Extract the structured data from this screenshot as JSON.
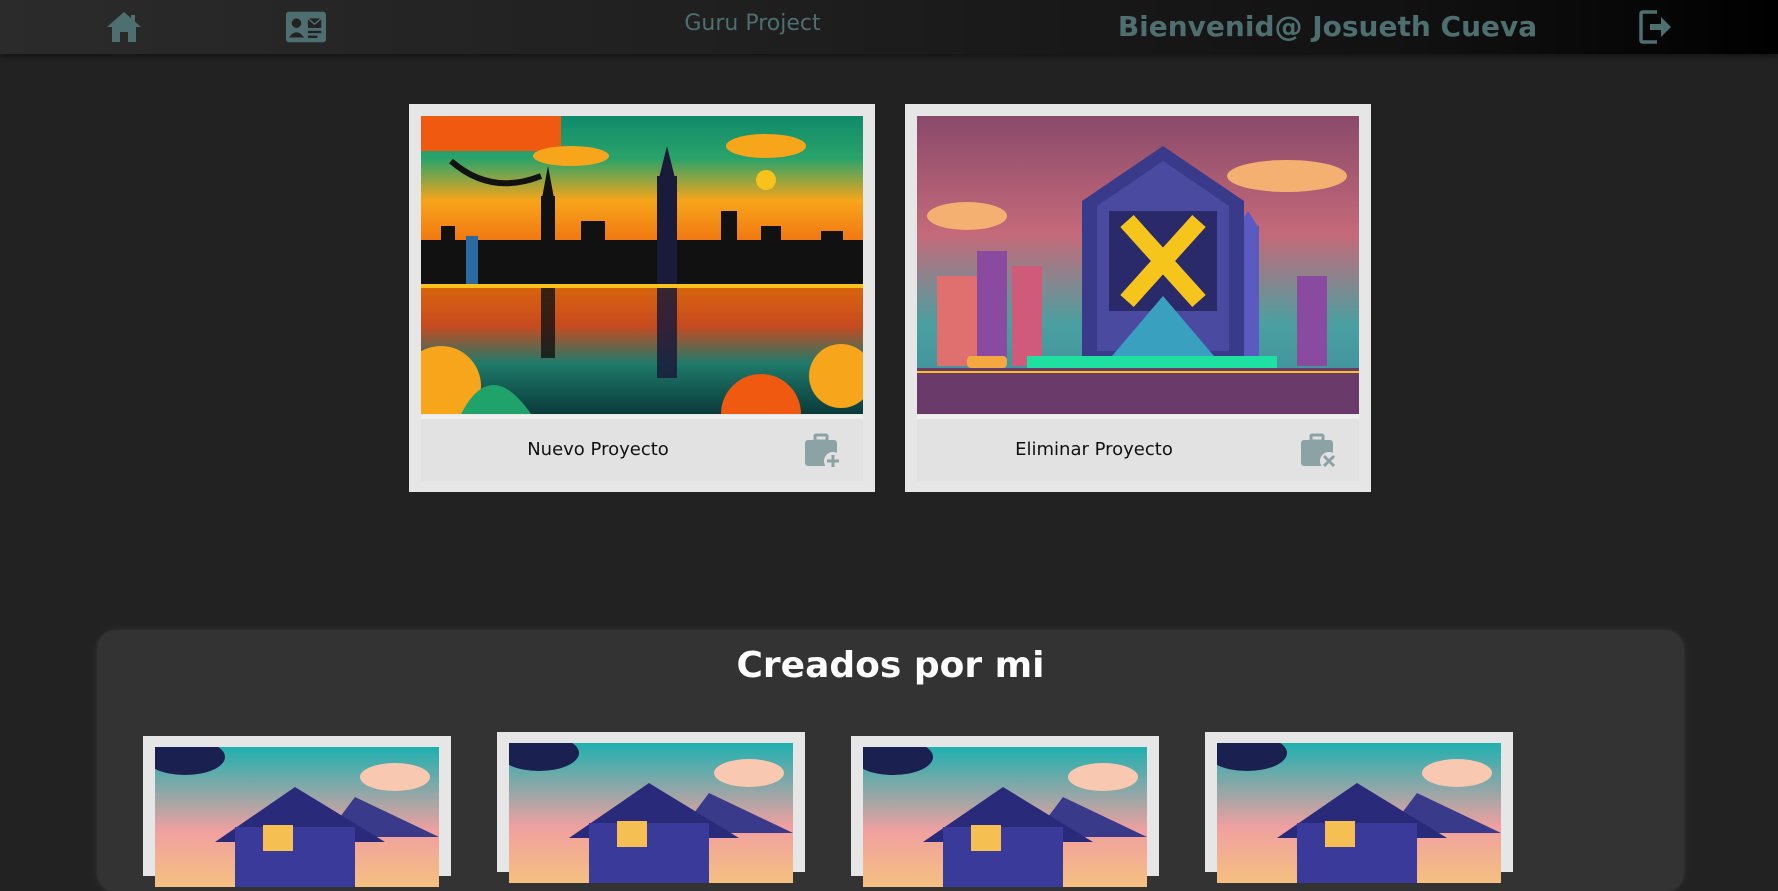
{
  "header": {
    "brand": "Guru Project",
    "welcome": "Bienvenid@ Josueth Cueva",
    "icons": [
      "home-icon",
      "contact-card-icon",
      "logout-icon"
    ],
    "icon_color": "#4e6e70"
  },
  "actions": [
    {
      "label": "Nuevo Proyecto",
      "icon": "briefcase-plus-icon"
    },
    {
      "label": "Eliminar Proyecto",
      "icon": "briefcase-x-icon"
    }
  ],
  "my_projects": {
    "title": "Creados por mi",
    "count_visible": 4
  },
  "colors": {
    "background": "#222222",
    "panel": "#333333",
    "card": "#e6e6e6",
    "accent": "#4e6e70"
  }
}
